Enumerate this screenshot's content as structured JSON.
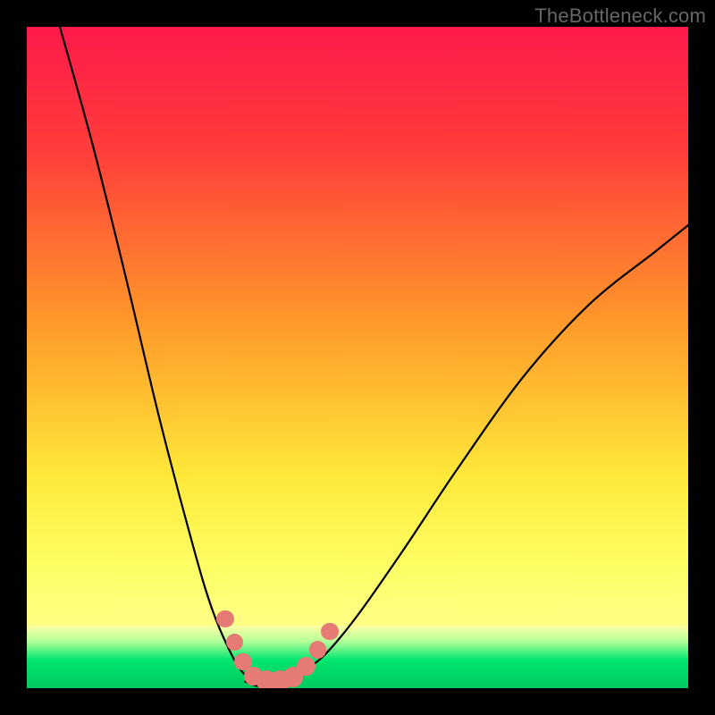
{
  "watermark": "TheBottleneck.com",
  "chart_data": {
    "type": "line",
    "title": "",
    "xlabel": "",
    "ylabel": "",
    "xlim": [
      0,
      100
    ],
    "ylim": [
      0,
      100
    ],
    "gradient_stops": [
      {
        "pct": 0,
        "color": "#ff1a4b"
      },
      {
        "pct": 18,
        "color": "#ff3b3b"
      },
      {
        "pct": 45,
        "color": "#ff9a2a"
      },
      {
        "pct": 68,
        "color": "#ffe93a"
      },
      {
        "pct": 82,
        "color": "#fdff66"
      },
      {
        "pct": 100,
        "color": "#ffffa8"
      }
    ],
    "green_band": {
      "top_pct": 90.5,
      "height_pct": 9.5
    },
    "series": [
      {
        "name": "left-arm",
        "x": [
          5,
          10,
          15,
          20,
          25,
          28,
          31,
          33,
          35
        ],
        "y": [
          100,
          82,
          62,
          41,
          22,
          12,
          5,
          2,
          1
        ]
      },
      {
        "name": "right-arm",
        "x": [
          41,
          45,
          50,
          57,
          65,
          75,
          85,
          95,
          100
        ],
        "y": [
          2,
          5,
          11,
          21,
          33,
          47,
          58,
          66,
          70
        ]
      },
      {
        "name": "valley-floor",
        "x": [
          33,
          35,
          38,
          41
        ],
        "y": [
          1,
          0.3,
          0.3,
          2
        ]
      }
    ],
    "beads": [
      {
        "x": 30.0,
        "y": 10.5,
        "r": 1.3
      },
      {
        "x": 31.4,
        "y": 7.0,
        "r": 1.3
      },
      {
        "x": 32.7,
        "y": 4.0,
        "r": 1.3
      },
      {
        "x": 34.3,
        "y": 1.8,
        "r": 1.4
      },
      {
        "x": 36.3,
        "y": 1.1,
        "r": 1.6
      },
      {
        "x": 38.3,
        "y": 1.1,
        "r": 1.6
      },
      {
        "x": 40.3,
        "y": 1.7,
        "r": 1.5
      },
      {
        "x": 42.2,
        "y": 3.3,
        "r": 1.4
      },
      {
        "x": 44.0,
        "y": 5.8,
        "r": 1.3
      },
      {
        "x": 45.8,
        "y": 8.6,
        "r": 1.3
      }
    ],
    "annotations": []
  }
}
